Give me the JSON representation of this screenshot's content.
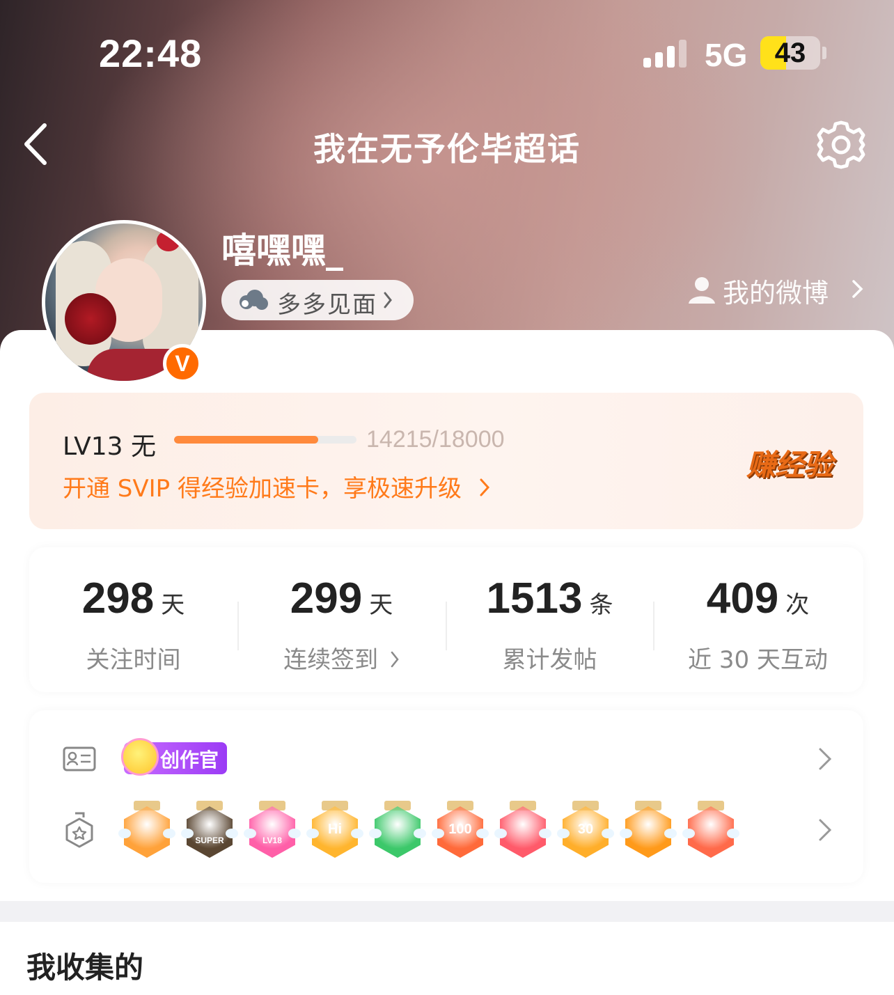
{
  "status_bar": {
    "time": "22:48",
    "network": "5G",
    "battery": "43",
    "battery_level": 0.43
  },
  "nav": {
    "title": "我在无予伦毕超话"
  },
  "profile": {
    "username": "嘻嘿嘿_",
    "group_label": "多多见面",
    "my_weibo_label": "我的微博",
    "verified_badge": "V"
  },
  "level": {
    "label": "LV13 无",
    "exp_text": "14215/18000",
    "progress": 0.79,
    "promo": "开通 SVIP 得经验加速卡，享极速升级",
    "earn_label": "赚经验"
  },
  "stats": [
    {
      "value": "298",
      "unit": "天",
      "label": "关注时间"
    },
    {
      "value": "299",
      "unit": "天",
      "label": "连续签到"
    },
    {
      "value": "1513",
      "unit": "条",
      "label": "累计发帖"
    },
    {
      "value": "409",
      "unit": "次",
      "label": "近 30 天互动"
    }
  ],
  "badges": {
    "creator_label": "创作官",
    "medals": [
      {
        "name": "crown-medal-icon",
        "color": "#ffa23a",
        "text": ""
      },
      {
        "name": "super-medal-icon",
        "color": "#5a4632",
        "text": "SUPER"
      },
      {
        "name": "lv18-medal-icon",
        "color": "#ff5fa8",
        "text": "LV18"
      },
      {
        "name": "hi-medal-icon",
        "color": "#ffb52e",
        "text": "Hi"
      },
      {
        "name": "hand-medal-icon",
        "color": "#3cc86a",
        "text": ""
      },
      {
        "name": "100-days-medal-icon",
        "color": "#ff6a3a",
        "text": "100"
      },
      {
        "name": "trophy-medal-icon",
        "color": "#ff5a6a",
        "text": ""
      },
      {
        "name": "30-days-medal-icon",
        "color": "#ffae2a",
        "text": "30"
      },
      {
        "name": "cheer-medal-icon",
        "color": "#ff9a1a",
        "text": ""
      },
      {
        "name": "rock-medal-icon",
        "color": "#ff6a4a",
        "text": ""
      }
    ]
  },
  "section": {
    "title": "我收集的"
  },
  "colors": {
    "accent": "#ff7a1a",
    "verified": "#ff6a00"
  }
}
